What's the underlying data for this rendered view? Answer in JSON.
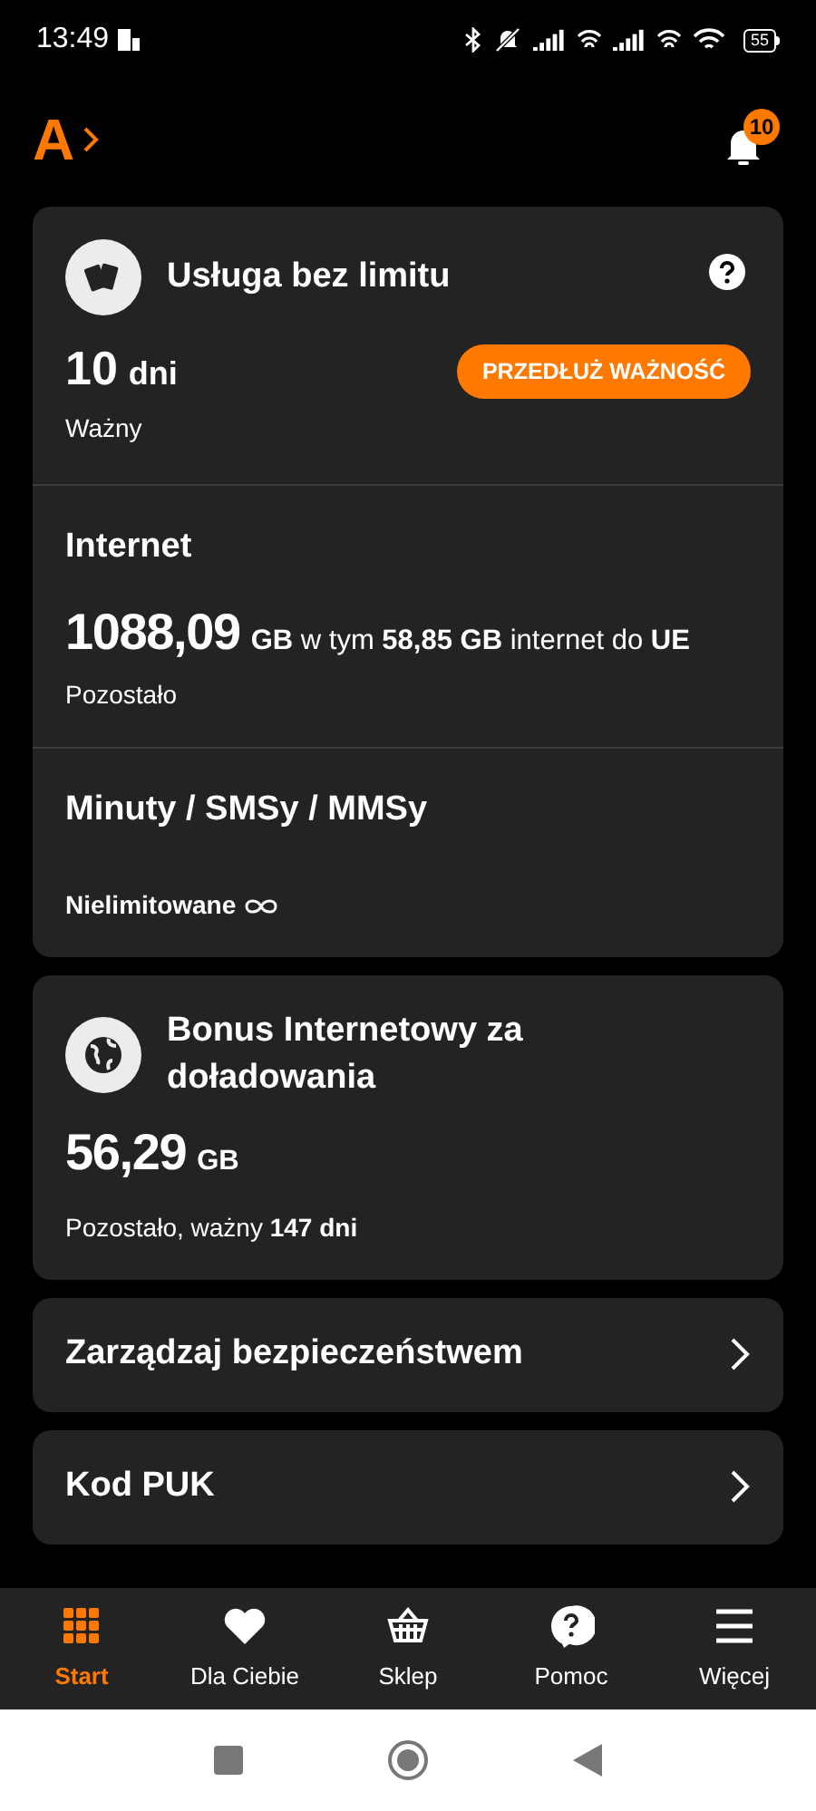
{
  "status_bar": {
    "time": "13:49",
    "battery": "55"
  },
  "header": {
    "logo": "A",
    "notification_count": "10"
  },
  "service_card": {
    "title": "Usługa bez limitu",
    "days_value": "10",
    "days_unit": "dni",
    "validity_label": "Ważny",
    "extend_button": "PRZEDŁUŻ WAŻNOŚĆ"
  },
  "internet": {
    "title": "Internet",
    "amount": "1088,09",
    "detail": "**GB** w tym **58,85 GB** internet do **UE**",
    "remaining_label": "Pozostało"
  },
  "minutes": {
    "title": "Minuty / SMSy / MMSy",
    "value": "Nielimitowane"
  },
  "bonus_card": {
    "title": "Bonus Internetowy za doładowania",
    "amount": "56,29",
    "unit": "GB",
    "note": "Pozostało, ważny **147 dni**"
  },
  "links": [
    "Zarządzaj bezpieczeństwem",
    "Kod PUK"
  ],
  "bottom_nav": [
    {
      "label": "Start",
      "selected": true
    },
    {
      "label": "Dla Ciebie",
      "selected": false
    },
    {
      "label": "Sklep",
      "selected": false
    },
    {
      "label": "Pomoc",
      "selected": false
    },
    {
      "label": "Więcej",
      "selected": false
    }
  ]
}
